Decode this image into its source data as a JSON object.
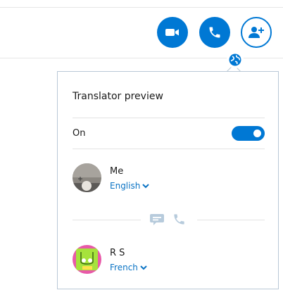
{
  "translator": {
    "title": "Translator preview",
    "toggle_label": "On",
    "toggle_state": "on"
  },
  "participants": [
    {
      "name": "Me",
      "language": "English"
    },
    {
      "name": "R    S",
      "language": "French"
    }
  ],
  "colors": {
    "accent": "#0078d4",
    "link": "#0a73c4",
    "muted_icon": "#b7cbdc"
  },
  "icons": {
    "video": "video-camera-icon",
    "audio": "phone-icon",
    "add": "add-person-icon",
    "translator": "globe-icon",
    "message": "chat-bubble-icon",
    "call": "phone-icon"
  }
}
